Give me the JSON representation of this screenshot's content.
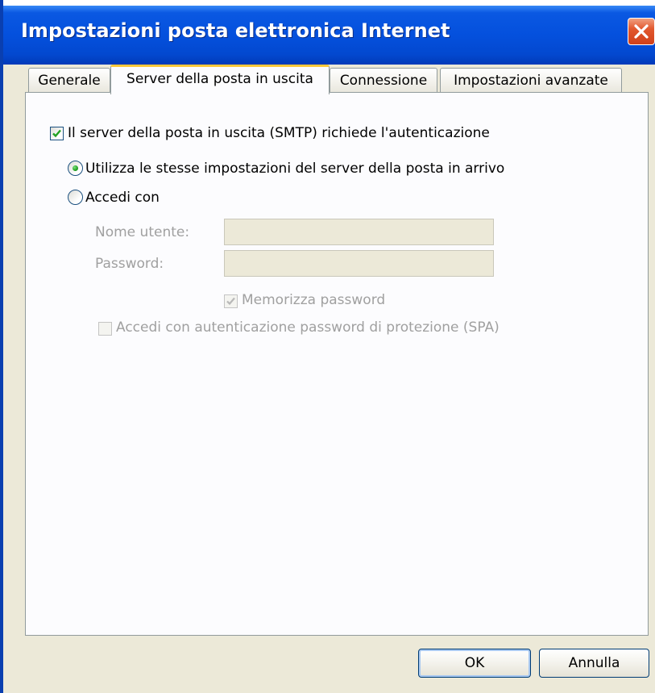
{
  "window": {
    "title": "Impostazioni posta elettronica Internet"
  },
  "colors": {
    "titlebar_blue": "#0450dd",
    "close_red": "#d0401a",
    "dialog_bg": "#ece9d8",
    "panel_bg": "#fcfcfe",
    "active_tab_accent": "#ffc83c",
    "disabled_text": "#a0a0a0",
    "radio_dot_green": "#21a121"
  },
  "icons": {
    "close": "close-icon",
    "checkmark": "checkmark-icon"
  },
  "tabs": [
    {
      "label": "Generale",
      "active": false
    },
    {
      "label": "Server della posta in uscita",
      "active": true
    },
    {
      "label": "Connessione",
      "active": false
    },
    {
      "label": "Impostazioni avanzate",
      "active": false
    }
  ],
  "smtp_auth": {
    "label": "Il server della posta in uscita (SMTP) richiede l'autenticazione",
    "checked": true
  },
  "auth_mode": {
    "same_settings_label": "Utilizza le stesse impostazioni del server della posta in arrivo",
    "same_settings_selected": true,
    "login_with_label": "Accedi con",
    "login_with_selected": false
  },
  "credentials": {
    "username_label": "Nome utente:",
    "username_value": "",
    "password_label": "Password:",
    "password_value": "",
    "remember_password_label": "Memorizza password",
    "remember_password_checked": true,
    "spa_label": "Accedi con autenticazione password di protezione (SPA)",
    "spa_checked": false
  },
  "buttons": {
    "ok": "OK",
    "cancel": "Annulla"
  }
}
